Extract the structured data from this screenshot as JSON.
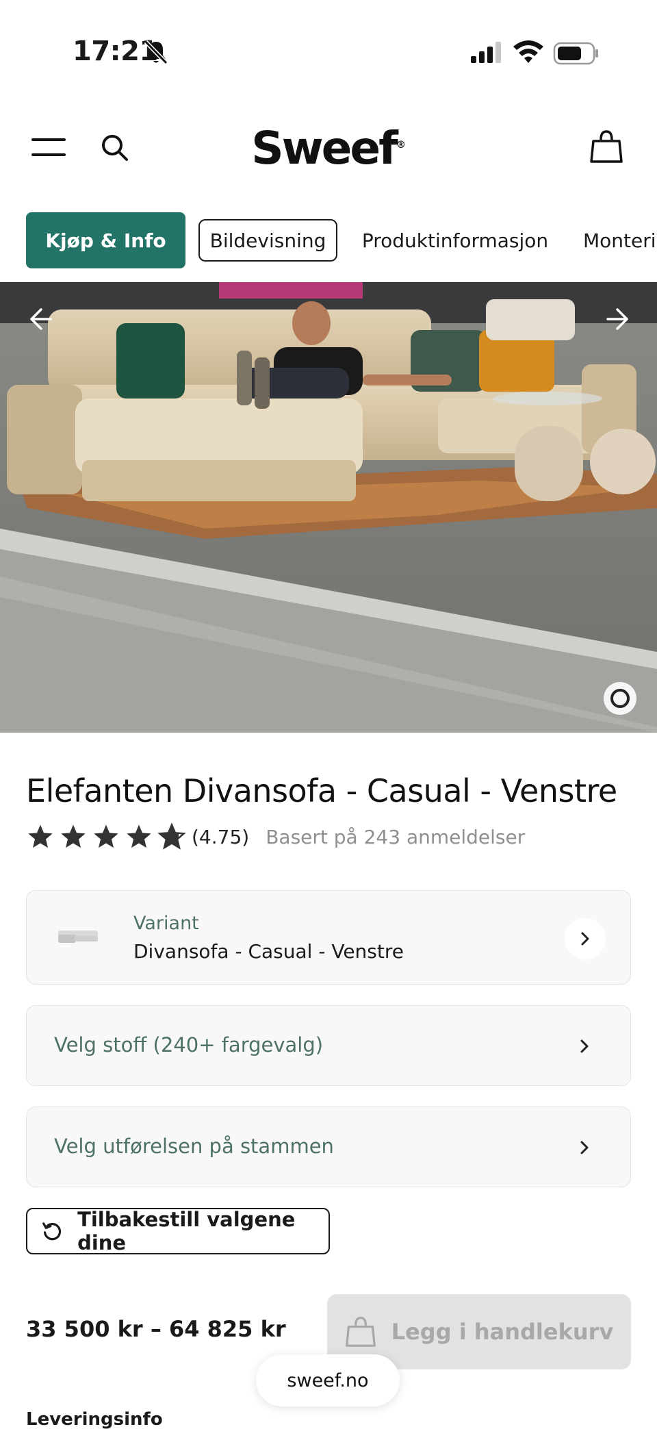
{
  "status_bar": {
    "time": "17:21"
  },
  "header": {
    "logo": "Sweef",
    "logo_mark": "®"
  },
  "tabs": [
    {
      "label": "Kjøp & Info"
    },
    {
      "label": "Bildevisning"
    },
    {
      "label": "Produktinformasjon"
    },
    {
      "label": "Monteri"
    }
  ],
  "gallery": {
    "slide_count": 6,
    "active_slide": 1
  },
  "product": {
    "title": "Elefanten Divansofa - Casual - Venstre",
    "rating_value": "(4.75)",
    "rating_score": 4.75,
    "rating_count_text": "Basert på 243 anmeldelser"
  },
  "options": {
    "variant_label": "Variant",
    "variant_value": "Divansofa - Casual - Venstre",
    "fabric_label": "Velg stoff (240+ fargevalg)",
    "stem_label": "Velg utførelsen på stammen"
  },
  "reset": {
    "label": "Tilbakestill valgene dine"
  },
  "purchase": {
    "price": "33 500 kr  –  64 825 kr",
    "add_to_cart_label": "Legg i handlekurv"
  },
  "browser": {
    "url": "sweef.no"
  },
  "delivery": {
    "heading": "Leveringsinfo"
  },
  "colors": {
    "accent": "#237468",
    "muted_text": "#4e7167",
    "disabled_bg": "#e2e2e2"
  }
}
